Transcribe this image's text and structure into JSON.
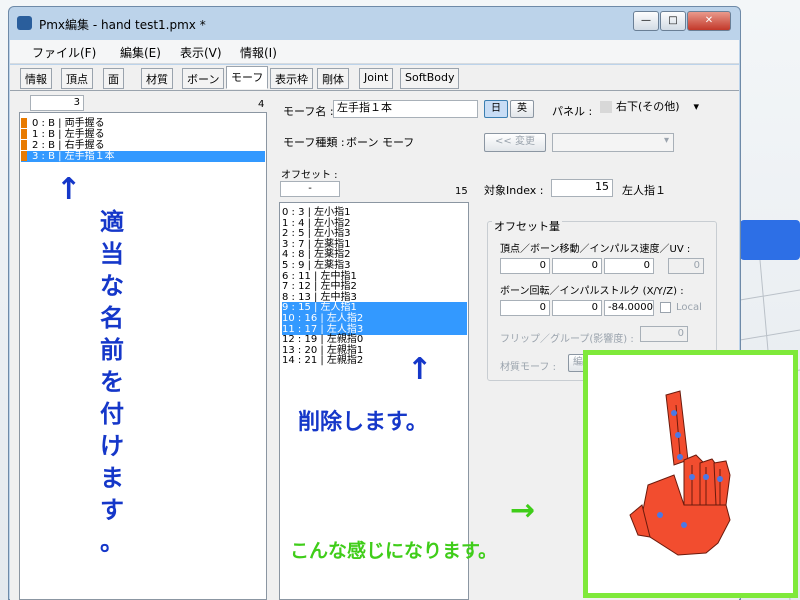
{
  "window": {
    "title": "Pmx編集 - hand test1.pmx *",
    "min": "—",
    "max": "□",
    "close": "✕"
  },
  "menu": [
    "ファイル(F)",
    "編集(E)",
    "表示(V)",
    "情報(I)"
  ],
  "tabs": [
    "情報",
    "頂点",
    "面",
    "材質",
    "ボーン",
    "モーフ",
    "表示枠",
    "剛体",
    "Joint",
    "SoftBody"
  ],
  "left": {
    "index": "3",
    "count": "4",
    "items": [
      "0 : B | 両手握る",
      "1 : B | 左手握る",
      "2 : B | 右手握る",
      "3 : B | 左手指１本"
    ]
  },
  "morph": {
    "name_label": "モーフ名 :",
    "name_value": "左手指１本",
    "lang_jp": "日",
    "lang_en": "英",
    "panel_label": "パネル :",
    "panel_value": "右下(その他)",
    "type_label": "モーフ種類 :",
    "type_value": "ボーン モーフ",
    "change_btn": "<< 変更"
  },
  "offset": {
    "label": "オフセット :",
    "value": "-",
    "count": "15",
    "target_label": "対象Index :",
    "target_value": "15",
    "target_name": "左人指１",
    "items": [
      "0 : 3 | 左小指1",
      "1 : 4 | 左小指2",
      "2 : 5 | 左小指3",
      "3 : 7 | 左薬指1",
      "4 : 8 | 左薬指2",
      "5 : 9 | 左薬指3",
      "6 : 11 | 左中指1",
      "7 : 12 | 左中指2",
      "8 : 13 | 左中指3",
      "9 : 15 | 左人指1",
      "10 : 16 | 左人指2",
      "11 : 17 | 左人指3",
      "12 : 19 | 左親指0",
      "13 : 20 | 左親指1",
      "14 : 21 | 左親指2"
    ],
    "selected": [
      9,
      10,
      11
    ]
  },
  "group": {
    "title": "オフセット量",
    "vertex_label": "頂点／ボーン移動／インパルス速度／UV :",
    "v": [
      "0",
      "0",
      "0",
      "0"
    ],
    "rot_label": "ボーン回転／インパルストルク (X/Y/Z) :",
    "r": [
      "0",
      "0",
      "-84.0000"
    ],
    "local": "Local",
    "flip_label": "フリップ／グループ(影響度) :",
    "flip_value": "0",
    "mat_label": "材質モーフ :",
    "mat_btn": "編"
  },
  "annotations": {
    "left_vertical": [
      "適",
      "当",
      "な",
      "名",
      "前",
      "を",
      "付",
      "け",
      "ま",
      "す",
      "。"
    ],
    "delete": "削除します。",
    "result": "こんな感じになります。",
    "arrow_up": "↑",
    "arrow_right": "→"
  }
}
